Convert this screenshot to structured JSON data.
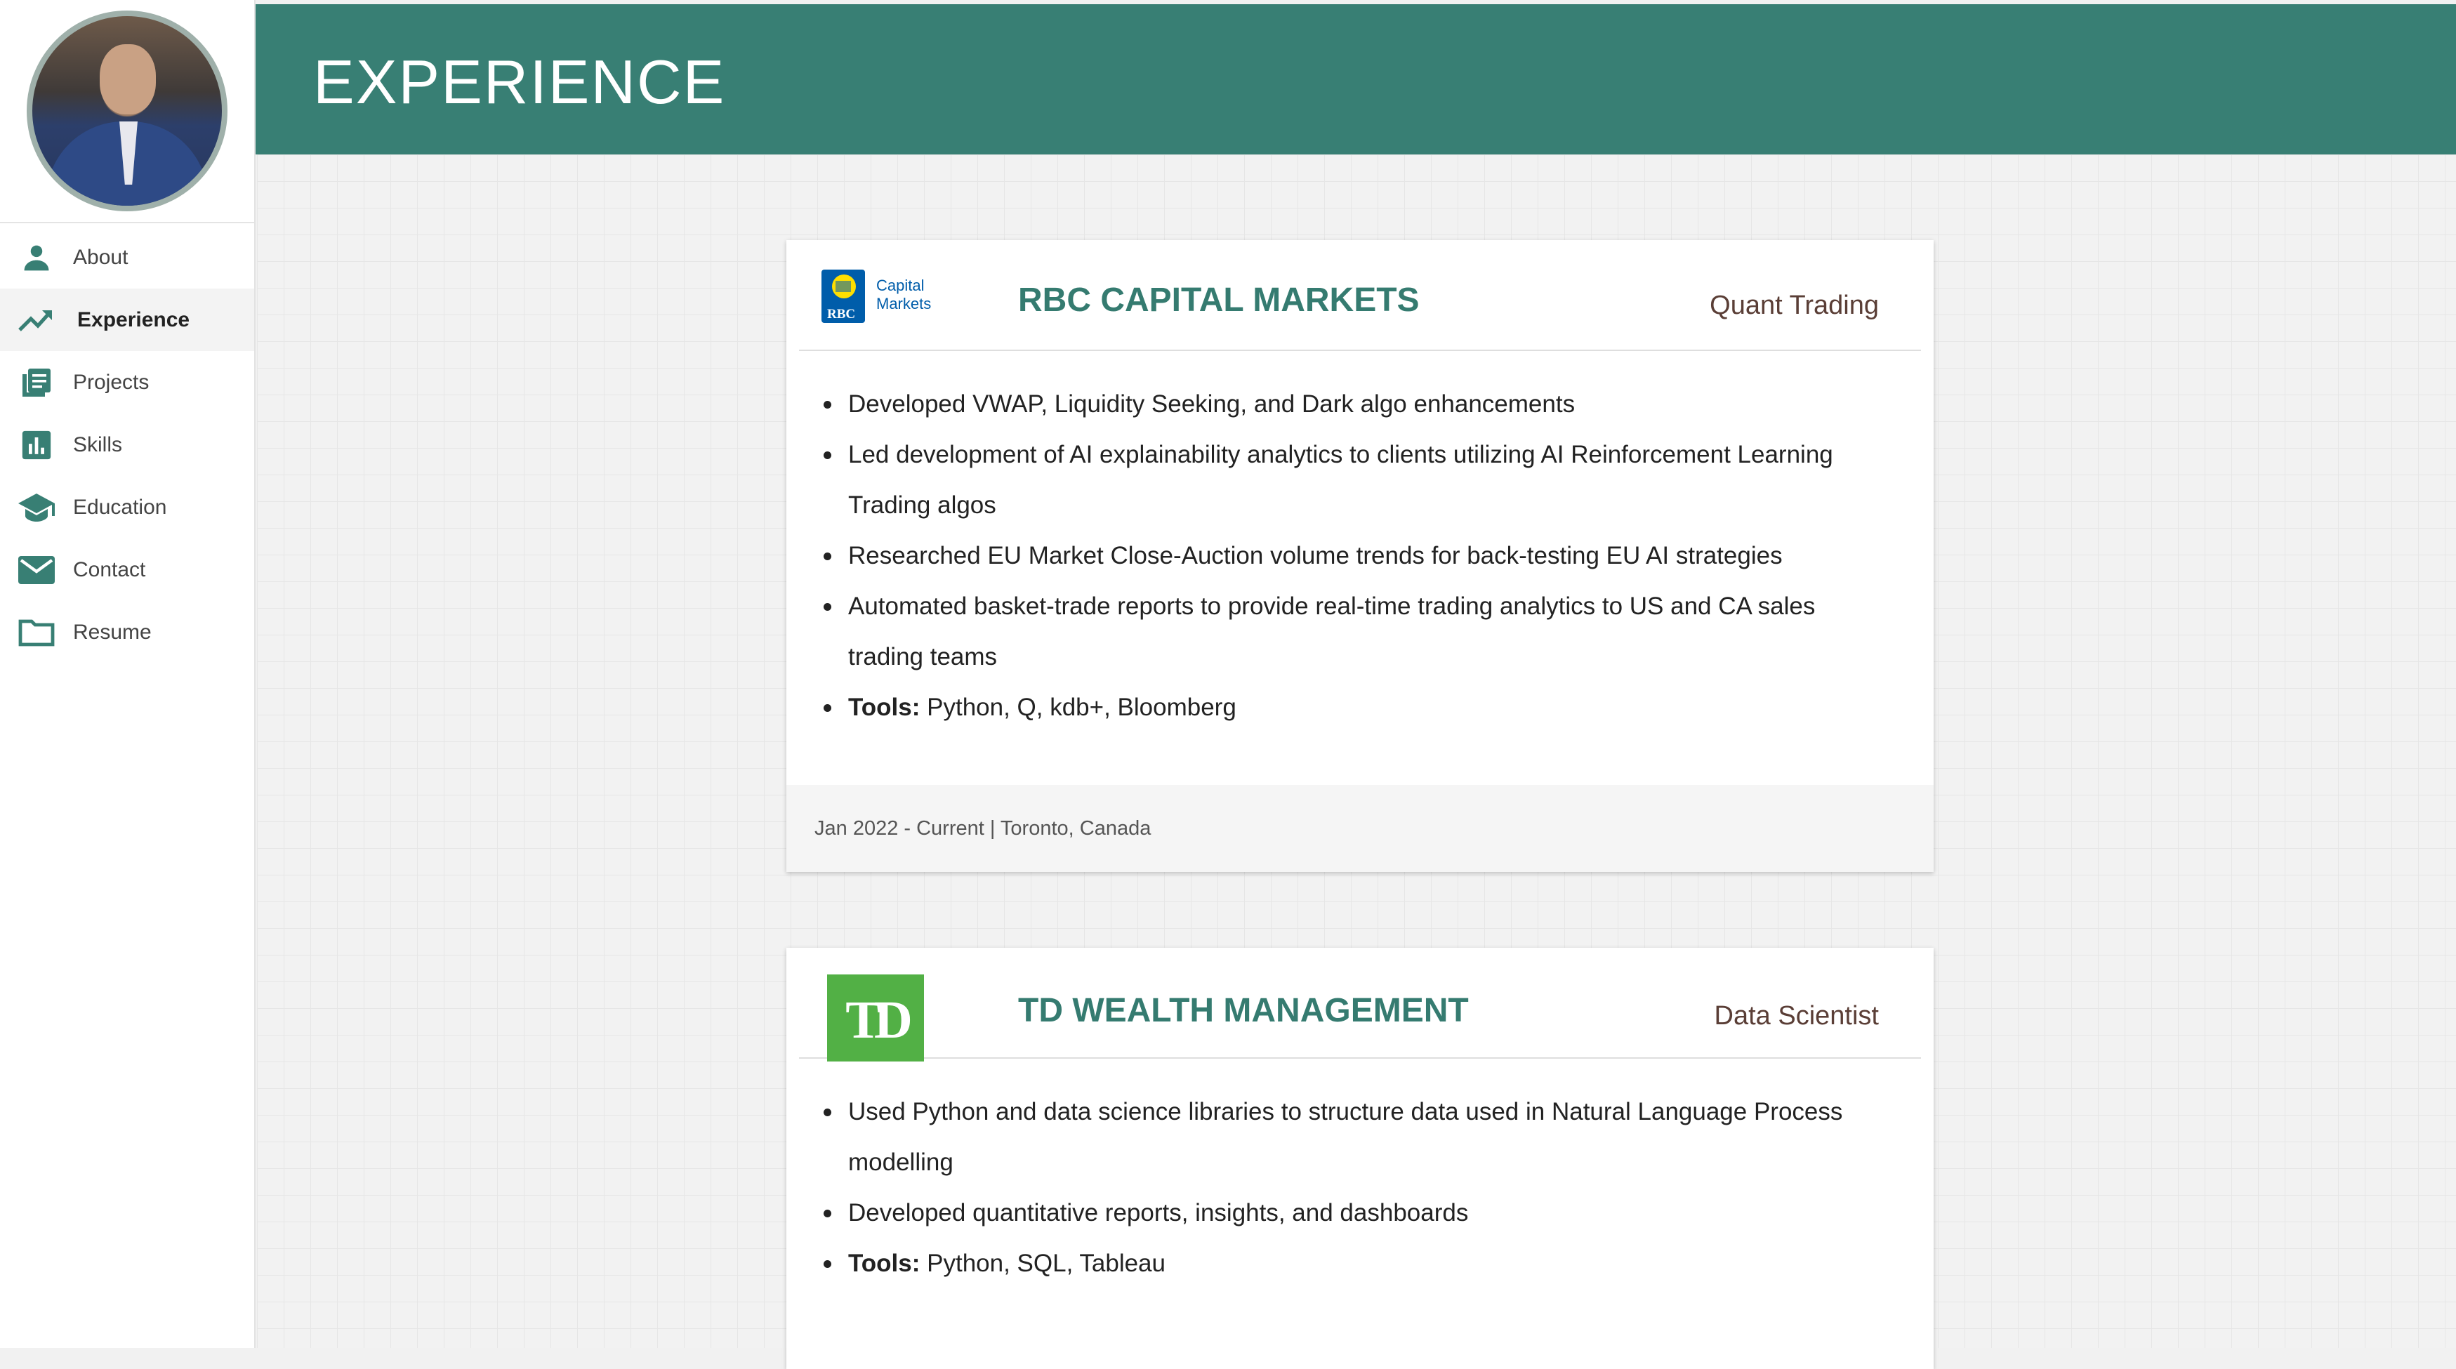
{
  "page_title": "EXPERIENCE",
  "sidebar": {
    "items": [
      {
        "label": "About",
        "icon": "person-icon"
      },
      {
        "label": "Experience",
        "icon": "trending-up-icon",
        "active": true
      },
      {
        "label": "Projects",
        "icon": "document-list-icon"
      },
      {
        "label": "Skills",
        "icon": "bar-chart-icon"
      },
      {
        "label": "Education",
        "icon": "graduation-cap-icon"
      },
      {
        "label": "Contact",
        "icon": "mail-icon"
      },
      {
        "label": "Resume",
        "icon": "folder-icon"
      }
    ]
  },
  "colors": {
    "accent": "#387f74",
    "company_text": "#357b70",
    "role_text": "#5a3e36",
    "td_green": "#52b045",
    "rbc_blue": "#005daa",
    "rbc_gold": "#fedf01"
  },
  "experiences": [
    {
      "company": "RBC CAPITAL MARKETS",
      "logo_text": [
        "Capital",
        "Markets"
      ],
      "logo_badge": "RBC",
      "role": "Quant Trading",
      "bullets": [
        "Developed VWAP, Liquidity Seeking, and Dark algo enhancements",
        "Led development of AI explainability analytics to clients utilizing AI Reinforcement Learning Trading algos",
        "Researched EU Market Close-Auction volume trends for back-testing EU AI strategies",
        "Automated basket-trade reports to provide real-time trading analytics to US and CA sales trading teams"
      ],
      "tools_label": "Tools:",
      "tools": "Python, Q, kdb+, Bloomberg",
      "footer": "Jan 2022 - Current | Toronto, Canada"
    },
    {
      "company": "TD WEALTH MANAGEMENT",
      "logo_badge": "TD",
      "role": "Data Scientist",
      "bullets": [
        "Used Python and data science libraries to structure data used in Natural Language Process modelling",
        "Developed quantitative reports, insights, and dashboards"
      ],
      "tools_label": "Tools:",
      "tools": "Python, SQL, Tableau"
    }
  ]
}
